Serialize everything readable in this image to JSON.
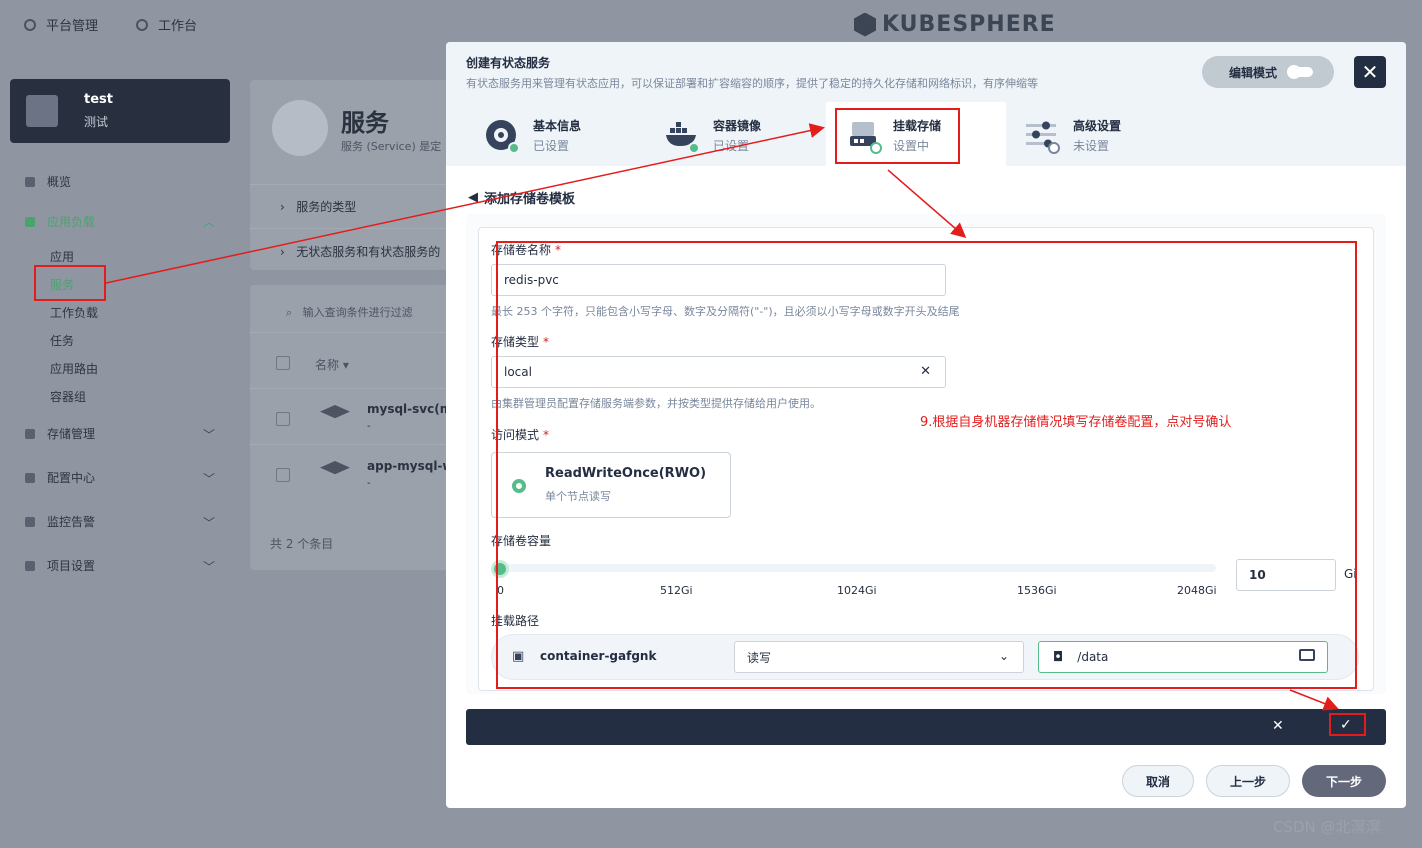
{
  "topnav": {
    "platform": "平台管理",
    "workbench": "工作台",
    "logo": "KUBESPHERE"
  },
  "workspace": {
    "name": "test",
    "desc": "测试"
  },
  "sidebar": {
    "overview": "概览",
    "app_workloads": "应用负载",
    "sub_items": [
      "应用",
      "服务",
      "工作负载",
      "任务",
      "应用路由",
      "容器组"
    ],
    "storage": "存储管理",
    "config": "配置中心",
    "monitoring": "监控告警",
    "project_settings": "项目设置"
  },
  "background": {
    "title": "服务",
    "desc": "服务 (Service) 是定",
    "type_row": "服务的类型",
    "stateless_row": "无状态服务和有状态服务的",
    "search_placeholder": "输入查询条件进行过滤",
    "col_name": "名称",
    "rows": [
      {
        "name": "mysql-svc(mys",
        "sub": "-"
      },
      {
        "name": "app-mysql-wy",
        "sub": "-"
      }
    ],
    "total": "共 2 个条目"
  },
  "modal": {
    "title": "创建有状态服务",
    "subtitle": "有状态服务用来管理有状态应用，可以保证部署和扩容缩容的顺序，提供了稳定的持久化存储和网络标识，有序伸缩等",
    "edit_mode": "编辑模式",
    "steps": [
      {
        "label": "基本信息",
        "status": "已设置",
        "icon": "info-disc-icon"
      },
      {
        "label": "容器镜像",
        "status": "已设置",
        "icon": "docker-whale-icon"
      },
      {
        "label": "挂载存储",
        "status": "设置中",
        "icon": "disk-icon"
      },
      {
        "label": "高级设置",
        "status": "未设置",
        "icon": "sliders-icon"
      }
    ],
    "back_label": "添加存储卷模板",
    "form": {
      "name_label": "存储卷名称",
      "name_value": "redis-pvc",
      "name_hint": "最长 253 个字符，只能包含小写字母、数字及分隔符(\"-\")，且必须以小写字母或数字开头及结尾",
      "class_label": "存储类型",
      "class_value": "local",
      "class_hint": "由集群管理员配置存储服务端参数，并按类型提供存储给用户使用。",
      "access_label": "访问模式",
      "access_mode": "ReadWriteOnce(RWO)",
      "access_desc": "单个节点读写",
      "capacity_label": "存储卷容量",
      "capacity_value": "10",
      "capacity_unit": "Gi",
      "ticks": [
        "0",
        "512Gi",
        "1024Gi",
        "1536Gi",
        "2048Gi"
      ],
      "mount_label": "挂载路径",
      "container": "container-gafgnk",
      "rw_mode": "读写",
      "mount_path": "/data"
    },
    "cancel": "取消",
    "prev": "上一步",
    "next": "下一步"
  },
  "annotation": "9.根据自身机器存储情况填写存储卷配置，点对号确认",
  "watermark": "CSDN @北溟溟",
  "colors": {
    "accent": "#55bc8a",
    "dark": "#242e42",
    "annotation_red": "#e31c1c"
  }
}
